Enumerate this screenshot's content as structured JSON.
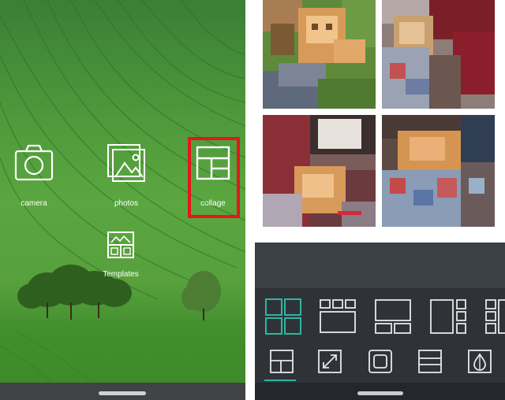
{
  "home_screen": {
    "apps": [
      {
        "label": "camera",
        "icon": "camera-icon"
      },
      {
        "label": "photos",
        "icon": "photos-icon"
      },
      {
        "label": "collage",
        "icon": "collage-icon",
        "highlighted": true
      },
      {
        "label": "Templates",
        "icon": "templates-icon"
      }
    ],
    "highlight_color": "#e8151b"
  },
  "collage_editor": {
    "photos": [
      {
        "icon": "photo-cat-grass"
      },
      {
        "icon": "photo-cat-chair"
      },
      {
        "icon": "photo-cat-tv"
      },
      {
        "icon": "photo-cat-blanket"
      }
    ],
    "layouts": [
      {
        "icon": "layout-2x2-icon",
        "selected": true
      },
      {
        "icon": "layout-3-over-1-icon"
      },
      {
        "icon": "layout-2-over-wide-icon"
      },
      {
        "icon": "layout-tall-plus-3-icon"
      },
      {
        "icon": "layout-side-stack-icon"
      }
    ],
    "tools": [
      {
        "icon": "layout-tool-icon",
        "selected": true
      },
      {
        "icon": "resize-tool-icon"
      },
      {
        "icon": "border-tool-icon"
      },
      {
        "icon": "spacing-tool-icon"
      },
      {
        "icon": "background-tool-icon"
      }
    ],
    "accent_color": "#2db6a3"
  }
}
